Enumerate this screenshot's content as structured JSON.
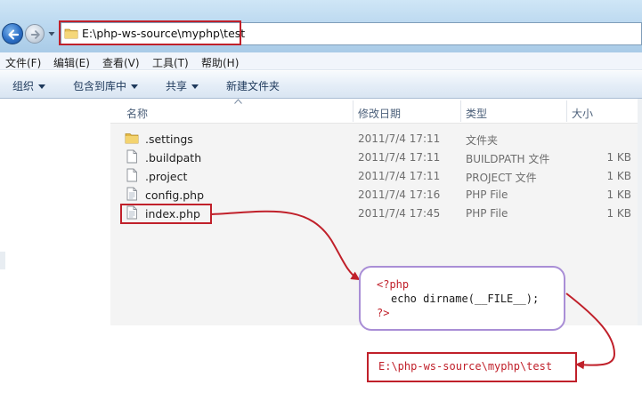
{
  "address_bar": {
    "path": "E:\\php-ws-source\\myphp\\test",
    "back_icon": "back-arrow-icon",
    "forward_icon": "forward-arrow-icon",
    "folder_icon": "folder-icon"
  },
  "menu": {
    "items": [
      "文件(F)",
      "编辑(E)",
      "查看(V)",
      "工具(T)",
      "帮助(H)"
    ]
  },
  "toolbar": {
    "organize": "组织",
    "include_in_library": "包含到库中",
    "share": "共享",
    "new_folder": "新建文件夹"
  },
  "columns": {
    "name": "名称",
    "date_modified": "修改日期",
    "type": "类型",
    "size": "大小"
  },
  "files": [
    {
      "name": ".settings",
      "date": "2011/7/4 17:11",
      "type": "文件夹",
      "size": "",
      "icon": "folder-icon"
    },
    {
      "name": ".buildpath",
      "date": "2011/7/4 17:11",
      "type": "BUILDPATH 文件",
      "size": "1 KB",
      "icon": "file-icon"
    },
    {
      "name": ".project",
      "date": "2011/7/4 17:11",
      "type": "PROJECT 文件",
      "size": "1 KB",
      "icon": "file-icon"
    },
    {
      "name": "config.php",
      "date": "2011/7/4 17:16",
      "type": "PHP File",
      "size": "1 KB",
      "icon": "php-file-icon"
    },
    {
      "name": "index.php",
      "date": "2011/7/4 17:45",
      "type": "PHP File",
      "size": "1 KB",
      "icon": "php-file-icon"
    }
  ],
  "annotation": {
    "code_lines": [
      "<?php",
      "echo dirname(__FILE__);",
      "?>"
    ],
    "result": "E:\\php-ws-source\\myphp\\test",
    "highlight_color": "#c0202a",
    "code_box_border": "#a98ed6"
  }
}
